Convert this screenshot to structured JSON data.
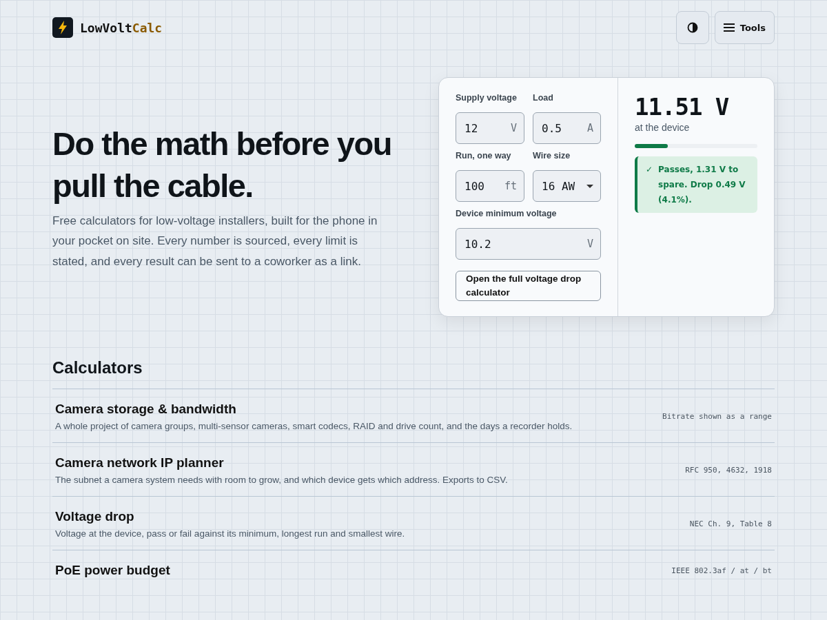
{
  "header": {
    "logo_text": "LowVolt",
    "logo_accent": "Calc",
    "buttons": [
      {
        "kind": "theme"
      },
      {
        "kind": "menu",
        "label": "Tools"
      }
    ]
  },
  "hero": {
    "title": "Do the math before you pull the cable.",
    "intro": "Free calculators for low-voltage installers, built for the phone in your pocket on site. Every number is sourced, every limit is stated, and every result can be sent to a coworker as a link."
  },
  "calculator": {
    "fields": [
      {
        "label": "Supply voltage",
        "value": "12",
        "unit": "V",
        "kind": "input"
      },
      {
        "label": "Load",
        "value": "0.5",
        "unit": "A",
        "kind": "input"
      },
      {
        "label": "Run, one way",
        "value": "100",
        "unit": "ft",
        "kind": "input"
      },
      {
        "label": "Wire size",
        "value": "16 AW",
        "kind": "select"
      },
      {
        "label": "Device minimum voltage",
        "value": "10.2",
        "unit": "V",
        "kind": "wide-input"
      }
    ],
    "link": "Open the full voltage drop calculator",
    "result": {
      "value": "11.51 V",
      "caption": "at the device",
      "level": 0.27,
      "passed": true,
      "message": "Passes, 1.31 V to spare. Drop 0.49 V (4.1%).",
      "mark": "✓"
    }
  },
  "calculators": {
    "heading": "Calculators",
    "items": [
      {
        "title": "Camera storage & bandwidth",
        "description": "A whole project of camera groups, multi-sensor cameras, smart codecs, RAID and drive count, and the days a recorder holds.",
        "note": "Bitrate shown as a range"
      },
      {
        "title": "Camera network IP planner",
        "description": "The subnet a camera system needs with room to grow, and which device gets which address. Exports to CSV.",
        "note": "RFC 950, 4632, 1918"
      },
      {
        "title": "Voltage drop",
        "description": "Voltage at the device, pass or fail against its minimum, longest run and smallest wire.",
        "note": "NEC Ch. 9, Table 8"
      },
      {
        "title": "PoE power budget",
        "note": "IEEE 802.3af / at / bt"
      }
    ]
  }
}
